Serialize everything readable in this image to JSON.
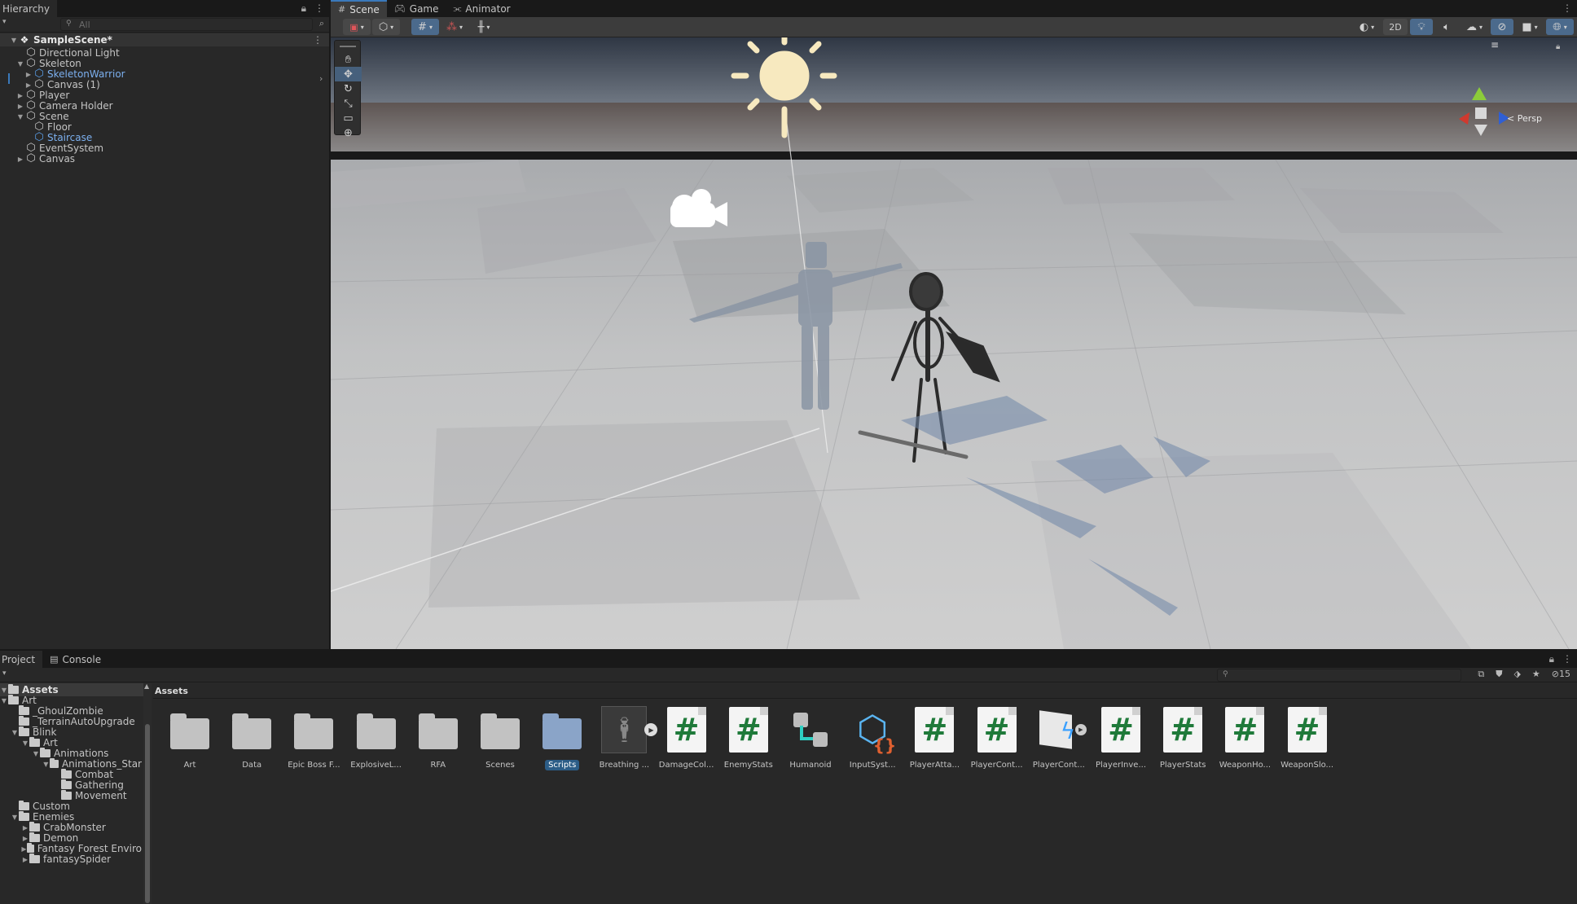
{
  "hierarchy": {
    "tab_label": "Hierarchy",
    "search_placeholder": "All",
    "scene_name": "SampleScene*",
    "items": [
      {
        "label": "Directional Light",
        "indent": 1,
        "arrow": "",
        "icon": "gameobject-icon",
        "color": "normal"
      },
      {
        "label": "Skeleton",
        "indent": 1,
        "arrow": "down",
        "icon": "gameobject-icon",
        "color": "normal"
      },
      {
        "label": "SkeletonWarrior",
        "indent": 2,
        "arrow": "right",
        "icon": "prefab-icon",
        "color": "blue"
      },
      {
        "label": "Canvas (1)",
        "indent": 2,
        "arrow": "right",
        "icon": "gameobject-icon",
        "color": "normal"
      },
      {
        "label": "Player",
        "indent": 1,
        "arrow": "right",
        "icon": "gameobject-icon",
        "color": "normal"
      },
      {
        "label": "Camera Holder",
        "indent": 1,
        "arrow": "right",
        "icon": "gameobject-icon",
        "color": "normal"
      },
      {
        "label": "Scene",
        "indent": 1,
        "arrow": "down",
        "icon": "gameobject-icon",
        "color": "normal"
      },
      {
        "label": "Floor",
        "indent": 2,
        "arrow": "",
        "icon": "gameobject-icon",
        "color": "normal"
      },
      {
        "label": "Staircase",
        "indent": 2,
        "arrow": "",
        "icon": "prefab-icon",
        "color": "blue"
      },
      {
        "label": "EventSystem",
        "indent": 1,
        "arrow": "",
        "icon": "gameobject-icon",
        "color": "normal"
      },
      {
        "label": "Canvas",
        "indent": 1,
        "arrow": "right",
        "icon": "gameobject-icon",
        "color": "normal"
      }
    ]
  },
  "scene_view": {
    "tabs": [
      {
        "label": "Scene",
        "icon": "grid-icon",
        "active": true
      },
      {
        "label": "Game",
        "icon": "gamepad-icon",
        "active": false
      },
      {
        "label": "Animator",
        "icon": "animator-icon",
        "active": false
      }
    ],
    "toolbar_2d_label": "2D",
    "persp_label": "Persp",
    "tools": [
      "hand-tool",
      "move-tool",
      "rotate-tool",
      "scale-tool",
      "rect-tool",
      "transform-tool"
    ],
    "active_tool": "move-tool"
  },
  "project": {
    "tabs": [
      {
        "label": "Project",
        "active": true
      },
      {
        "label": "Console",
        "active": false
      }
    ],
    "root_label": "Assets",
    "breadcrumb": "Assets",
    "hidden_count": "15",
    "folder_tree": [
      {
        "label": "Art",
        "indent": 0,
        "arrow": "down"
      },
      {
        "label": "_GhoulZombie",
        "indent": 1,
        "arrow": ""
      },
      {
        "label": "_TerrainAutoUpgrade",
        "indent": 1,
        "arrow": ""
      },
      {
        "label": "Blink",
        "indent": 1,
        "arrow": "down"
      },
      {
        "label": "Art",
        "indent": 2,
        "arrow": "down"
      },
      {
        "label": "Animations",
        "indent": 3,
        "arrow": "down"
      },
      {
        "label": "Animations_Star",
        "indent": 4,
        "arrow": "down"
      },
      {
        "label": "Combat",
        "indent": 5,
        "arrow": ""
      },
      {
        "label": "Gathering",
        "indent": 5,
        "arrow": ""
      },
      {
        "label": "Movement",
        "indent": 5,
        "arrow": ""
      },
      {
        "label": "Custom",
        "indent": 1,
        "arrow": ""
      },
      {
        "label": "Enemies",
        "indent": 1,
        "arrow": "down"
      },
      {
        "label": "CrabMonster",
        "indent": 2,
        "arrow": "right"
      },
      {
        "label": "Demon",
        "indent": 2,
        "arrow": "right"
      },
      {
        "label": "Fantasy Forest Enviro",
        "indent": 2,
        "arrow": "right"
      },
      {
        "label": "fantasySpider",
        "indent": 2,
        "arrow": "right"
      }
    ],
    "assets": [
      {
        "label": "Art",
        "type": "folder"
      },
      {
        "label": "Data",
        "type": "folder"
      },
      {
        "label": "Epic Boss F...",
        "type": "folder"
      },
      {
        "label": "ExplosiveL...",
        "type": "folder"
      },
      {
        "label": "RFA",
        "type": "folder"
      },
      {
        "label": "Scenes",
        "type": "folder"
      },
      {
        "label": "Scripts",
        "type": "folder-selected"
      },
      {
        "label": "Breathing ...",
        "type": "animation"
      },
      {
        "label": "DamageCol...",
        "type": "script"
      },
      {
        "label": "EnemyStats",
        "type": "script"
      },
      {
        "label": "Humanoid",
        "type": "humanoid"
      },
      {
        "label": "InputSyst...",
        "type": "input-actions"
      },
      {
        "label": "PlayerAtta...",
        "type": "script"
      },
      {
        "label": "PlayerCont...",
        "type": "script"
      },
      {
        "label": "PlayerCont...",
        "type": "input-map"
      },
      {
        "label": "PlayerInve...",
        "type": "script"
      },
      {
        "label": "PlayerStats",
        "type": "script"
      },
      {
        "label": "WeaponHo...",
        "type": "script"
      },
      {
        "label": "WeaponSlo...",
        "type": "script"
      }
    ]
  },
  "colors": {
    "accent": "#3a79bb",
    "prefab_blue": "#7cb0ef",
    "script_green": "#1f7a3a",
    "selection": "#2c5d87"
  }
}
